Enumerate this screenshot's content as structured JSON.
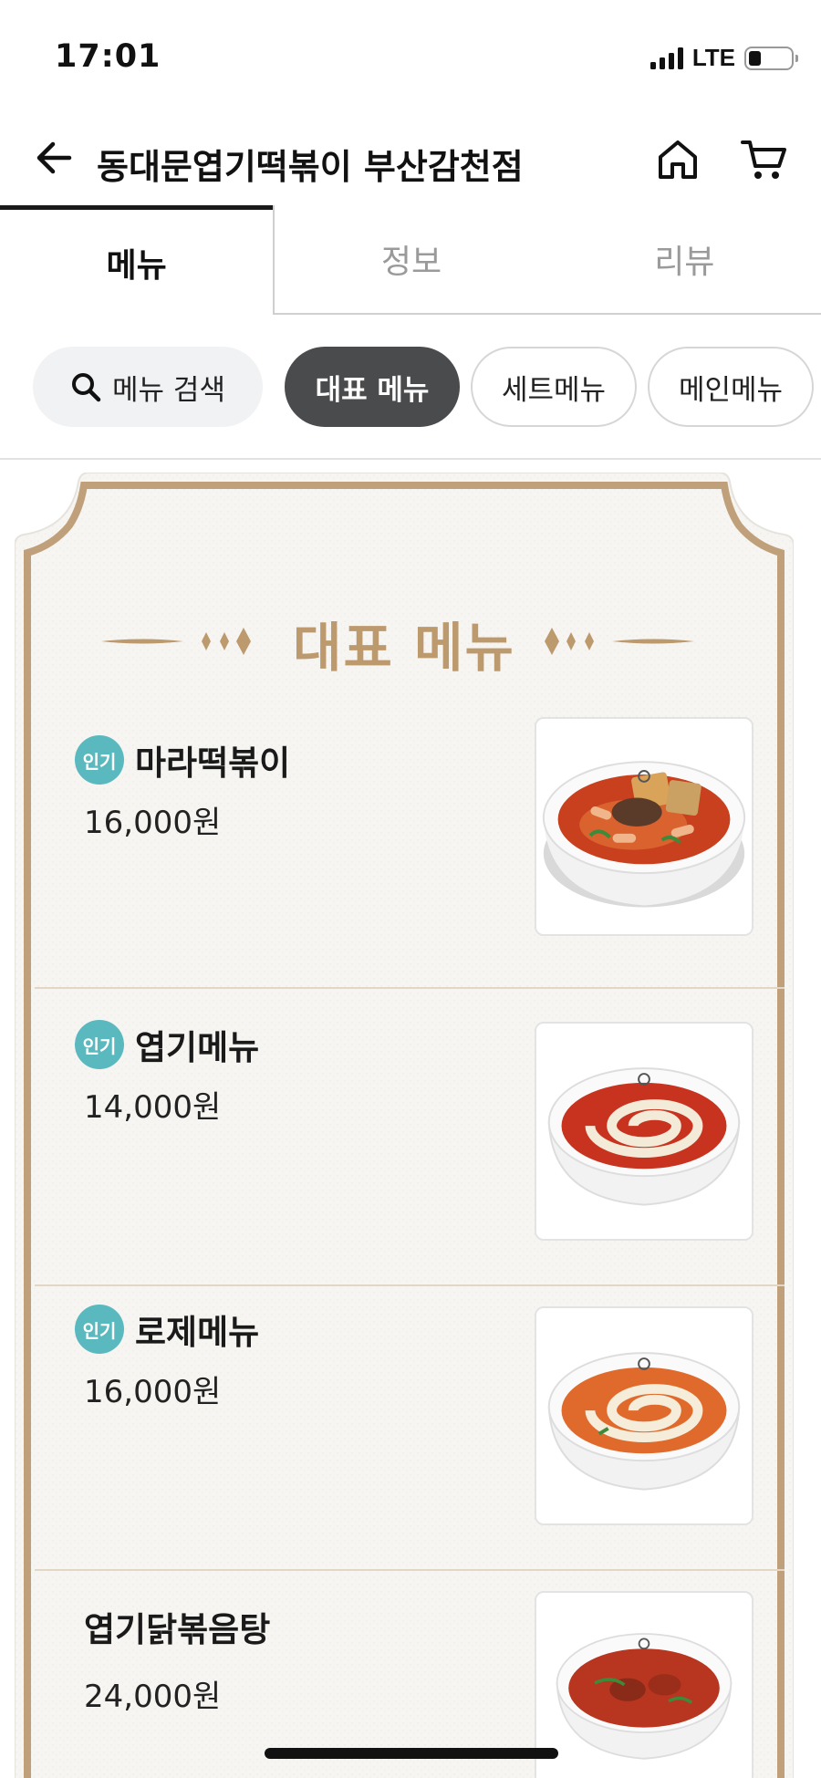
{
  "status_bar": {
    "time": "17:01",
    "network": "LTE"
  },
  "header": {
    "store_title": "동대문엽기떡볶이 부산감천점"
  },
  "tabs": [
    {
      "label": "메뉴",
      "active": true
    },
    {
      "label": "정보",
      "active": false
    },
    {
      "label": "리뷰",
      "active": false
    }
  ],
  "chips": {
    "search_label": "메뉴 검색",
    "items": [
      {
        "label": "대표 메뉴",
        "active": true
      },
      {
        "label": "세트메뉴",
        "active": false
      },
      {
        "label": "메인메뉴",
        "active": false
      }
    ]
  },
  "section": {
    "title": "대표 메뉴"
  },
  "menu_items": [
    {
      "badge": "인기",
      "name": "마라떡볶이",
      "price": "16,000원",
      "image": "mala-tteokbokki-bowl"
    },
    {
      "badge": "인기",
      "name": "엽기메뉴",
      "price": "14,000원",
      "image": "yupgi-tteokbokki-cream-swirl-bowl"
    },
    {
      "badge": "인기",
      "name": "로제메뉴",
      "price": "16,000원",
      "image": "rose-tteokbokki-cream-swirl-bowl"
    },
    {
      "badge": "",
      "name": "엽기닭볶음탕",
      "price": "24,000원",
      "image": "dakbokkeumtang-bowl"
    }
  ],
  "colors": {
    "accent_gold": "#bd9a6e",
    "badge_teal": "#5ab9bf",
    "active_chip": "#4a4b4d"
  }
}
